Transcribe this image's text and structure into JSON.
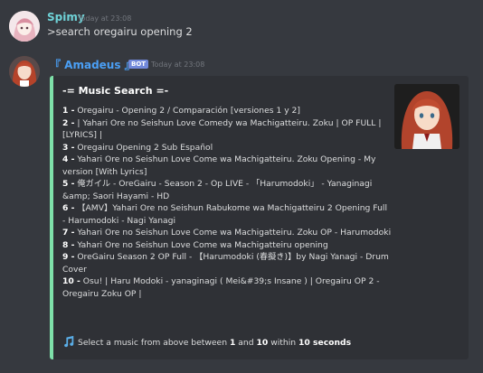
{
  "message1": {
    "username": "Spimy",
    "username_color": "#6fd3d8",
    "timestamp": "Today at 23:08",
    "text": ">search oregairu opening 2"
  },
  "message2": {
    "username": "『 Amadeus 』",
    "username_color": "#4a9ff5",
    "badge": "BOT",
    "timestamp": "Today at 23:08"
  },
  "embed": {
    "accent_color": "#7ee0a9",
    "title": "-= Music Search =-",
    "results": [
      {
        "num": "1 -",
        "text": " Oregairu - Opening 2 / Comparación [versiones 1 y 2]"
      },
      {
        "num": "2 -",
        "text": " | Yahari Ore no Seishun Love Comedy wa Machigatteiru. Zoku | OP FULL | [LYRICS] |"
      },
      {
        "num": "3 -",
        "text": " Oregairu Opening 2 Sub Español"
      },
      {
        "num": "4 -",
        "text": " Yahari Ore no Seishun Love Come wa Machigatteiru. Zoku Opening - My version [With Lyrics]"
      },
      {
        "num": "5 -",
        "text": " 俺ガイル - OreGairu - Season 2 - Op LIVE - 「Harumodoki」 - Yanaginagi &amp; Saori Hayami - HD"
      },
      {
        "num": "6 -",
        "text": " 【AMV】Yahari Ore no Seishun Rabukome wa Machigatteiru 2 Opening Full - Harumodoki - Nagi Yanagi"
      },
      {
        "num": "7 -",
        "text": " Yahari Ore no Seishun Love Come wa Machigatteiru. Zoku OP - Harumodoki"
      },
      {
        "num": "8 -",
        "text": " Yahari Ore no Seishun Love Come wa Machigatteiru opening"
      },
      {
        "num": "9 -",
        "text": " OreGairu Season 2 OP Full - 【Harumodoki (春擬き)】by Nagi Yanagi - Drum Cover"
      },
      {
        "num": "10 -",
        "text": " Osu! | Haru Modoki - yanaginagi ( Mei&#39;s Insane ) | Oregairu OP 2 - Oregairu Zoku OP |"
      }
    ],
    "footer": {
      "icon": "music-note-icon",
      "prefix": "Select a music from above between ",
      "min": "1",
      "middle": " and ",
      "max": "10",
      "within": " within ",
      "time": "10 seconds"
    }
  }
}
